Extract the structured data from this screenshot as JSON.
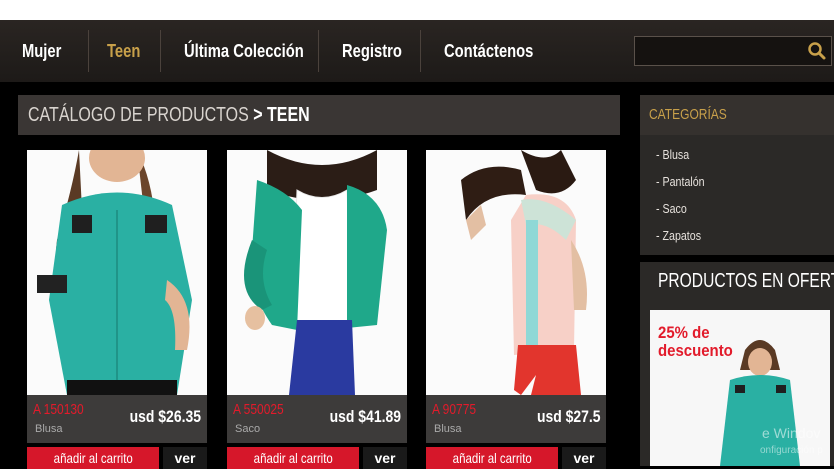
{
  "nav": {
    "items": [
      {
        "label": "Mujer"
      },
      {
        "label": "Teen"
      },
      {
        "label": "Última Colección"
      },
      {
        "label": "Registro"
      },
      {
        "label": "Contáctenos"
      }
    ],
    "active": "Teen",
    "search": {
      "value": "",
      "icon": "search-icon"
    }
  },
  "catalog": {
    "title_prefix": "CATÁLOGO DE PRODUCTOS",
    "separator": ">",
    "title_current": "TEEN"
  },
  "products": [
    {
      "code": "A 150130",
      "type": "Blusa",
      "price": "usd $26.35",
      "cart_label": "añadir al carrito",
      "view_label": "ver"
    },
    {
      "code": "A 550025",
      "type": "Saco",
      "price": "usd $41.89",
      "cart_label": "añadir al carrito",
      "view_label": "ver"
    },
    {
      "code": "A 90775",
      "type": "Blusa",
      "price": "usd $27.5",
      "cart_label": "añadir al carrito",
      "view_label": "ver"
    }
  ],
  "sidebar": {
    "categories_title": "CATEGORÍAS",
    "categories": [
      "- Blusa",
      "- Pantalón",
      "- Saco",
      "- Zapatos"
    ],
    "offers_title": "PRODUCTOS EN OFERTA",
    "offer_line1": "25% de",
    "offer_line2": "descuento"
  },
  "watermark": {
    "line1": "e Windov",
    "line2": "onfiguración p"
  },
  "colors": {
    "accent_gold": "#c8a04a",
    "accent_red": "#d6172a",
    "price_code_red": "#e21b2b"
  }
}
